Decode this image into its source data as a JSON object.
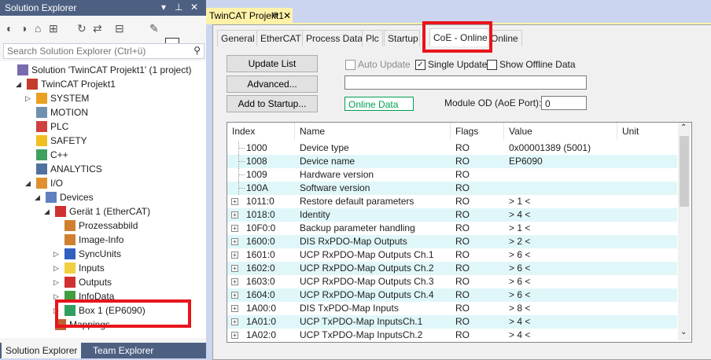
{
  "solution_explorer": {
    "title": "Solution Explorer",
    "title_controls": [
      "▾",
      "⊥",
      "✕"
    ],
    "search_placeholder": "Search Solution Explorer (Ctrl+ü)",
    "tree": [
      {
        "label": "Solution 'TwinCAT Projekt1' (1 project)",
        "icon": "solution-icon",
        "arrow": ""
      },
      {
        "label": "TwinCAT Projekt1",
        "icon": "project-icon",
        "arrow": "◢"
      },
      {
        "label": "SYSTEM",
        "icon": "system-icon",
        "arrow": "▷"
      },
      {
        "label": "MOTION",
        "icon": "motion-icon",
        "arrow": ""
      },
      {
        "label": "PLC",
        "icon": "plc-icon",
        "arrow": ""
      },
      {
        "label": "SAFETY",
        "icon": "safety-icon",
        "arrow": ""
      },
      {
        "label": "C++",
        "icon": "cpp-icon",
        "arrow": ""
      },
      {
        "label": "ANALYTICS",
        "icon": "analytics-icon",
        "arrow": ""
      },
      {
        "label": "I/O",
        "icon": "io-icon",
        "arrow": "◢"
      },
      {
        "label": "Devices",
        "icon": "devices-icon",
        "arrow": "◢"
      },
      {
        "label": "Gerät 1 (EtherCAT)",
        "icon": "ethercat-device-icon",
        "arrow": "◢"
      },
      {
        "label": "Prozessabbild",
        "icon": "process-image-icon",
        "arrow": ""
      },
      {
        "label": "Image-Info",
        "icon": "image-info-icon",
        "arrow": ""
      },
      {
        "label": "SyncUnits",
        "icon": "sync-units-icon",
        "arrow": "▷"
      },
      {
        "label": "Inputs",
        "icon": "inputs-folder-icon",
        "arrow": "▷"
      },
      {
        "label": "Outputs",
        "icon": "outputs-folder-icon",
        "arrow": "▷"
      },
      {
        "label": "InfoData",
        "icon": "infodata-icon",
        "arrow": "▷"
      },
      {
        "label": "Box 1 (EP6090)",
        "icon": "box-icon",
        "arrow": "▷"
      },
      {
        "label": "Mappings",
        "icon": "mappings-icon",
        "arrow": ""
      }
    ],
    "bottom_tabs": [
      "Solution Explorer",
      "Team Explorer"
    ]
  },
  "document": {
    "tab_title": "TwinCAT Projekt1",
    "tab_pin": "⊕",
    "tab_close": "✕",
    "subtabs": [
      "General",
      "EtherCAT",
      "Process Data",
      "Plc",
      "Startup",
      "CoE - Online",
      "Online"
    ],
    "active_subtab": "CoE - Online",
    "buttons": {
      "update_list": "Update List",
      "advanced": "Advanced...",
      "add_to_startup": "Add to Startup..."
    },
    "checkboxes": {
      "auto_update": {
        "label": "Auto Update",
        "checked": false
      },
      "single_update": {
        "label": "Single Update",
        "checked": true
      },
      "show_offline": {
        "label": "Show Offline Data",
        "checked": false
      }
    },
    "online_data_label": "Online Data",
    "module_od_label": "Module OD (AoE Port):",
    "module_od_value": "0",
    "advanced_field_value": ""
  },
  "grid": {
    "columns": [
      "Index",
      "Name",
      "Flags",
      "Value",
      "Unit"
    ],
    "rows": [
      {
        "index": "1000",
        "name": "Device type",
        "flags": "RO",
        "value": "0x00001389 (5001)",
        "expandable": false
      },
      {
        "index": "1008",
        "name": "Device name",
        "flags": "RO",
        "value": "EP6090",
        "expandable": false
      },
      {
        "index": "1009",
        "name": "Hardware version",
        "flags": "RO",
        "value": "",
        "expandable": false
      },
      {
        "index": "100A",
        "name": "Software version",
        "flags": "RO",
        "value": "",
        "expandable": false
      },
      {
        "index": "1011:0",
        "name": "Restore default parameters",
        "flags": "RO",
        "value": "> 1 <",
        "expandable": true
      },
      {
        "index": "1018:0",
        "name": "Identity",
        "flags": "RO",
        "value": "> 4 <",
        "expandable": true
      },
      {
        "index": "10F0:0",
        "name": "Backup parameter handling",
        "flags": "RO",
        "value": "> 1 <",
        "expandable": true
      },
      {
        "index": "1600:0",
        "name": "DIS RxPDO-Map Outputs",
        "flags": "RO",
        "value": "> 2 <",
        "expandable": true
      },
      {
        "index": "1601:0",
        "name": "UCP RxPDO-Map Outputs Ch.1",
        "flags": "RO",
        "value": "> 6 <",
        "expandable": true
      },
      {
        "index": "1602:0",
        "name": "UCP RxPDO-Map Outputs Ch.2",
        "flags": "RO",
        "value": "> 6 <",
        "expandable": true
      },
      {
        "index": "1603:0",
        "name": "UCP RxPDO-Map Outputs Ch.3",
        "flags": "RO",
        "value": "> 6 <",
        "expandable": true
      },
      {
        "index": "1604:0",
        "name": "UCP RxPDO-Map Outputs Ch.4",
        "flags": "RO",
        "value": "> 6 <",
        "expandable": true
      },
      {
        "index": "1A00:0",
        "name": "DIS TxPDO-Map Inputs",
        "flags": "RO",
        "value": "> 8 <",
        "expandable": true
      },
      {
        "index": "1A01:0",
        "name": "UCP TxPDO-Map InputsCh.1",
        "flags": "RO",
        "value": "> 4 <",
        "expandable": true
      },
      {
        "index": "1A02:0",
        "name": "UCP TxPDO-Map InputsCh.2",
        "flags": "RO",
        "value": "> 4 <",
        "expandable": true
      }
    ]
  },
  "colors": {
    "highlight": "#e8141c",
    "row_alt": "#e0f7fa",
    "title_bar": "#4d6082",
    "doc_tab": "#fff2a8"
  }
}
